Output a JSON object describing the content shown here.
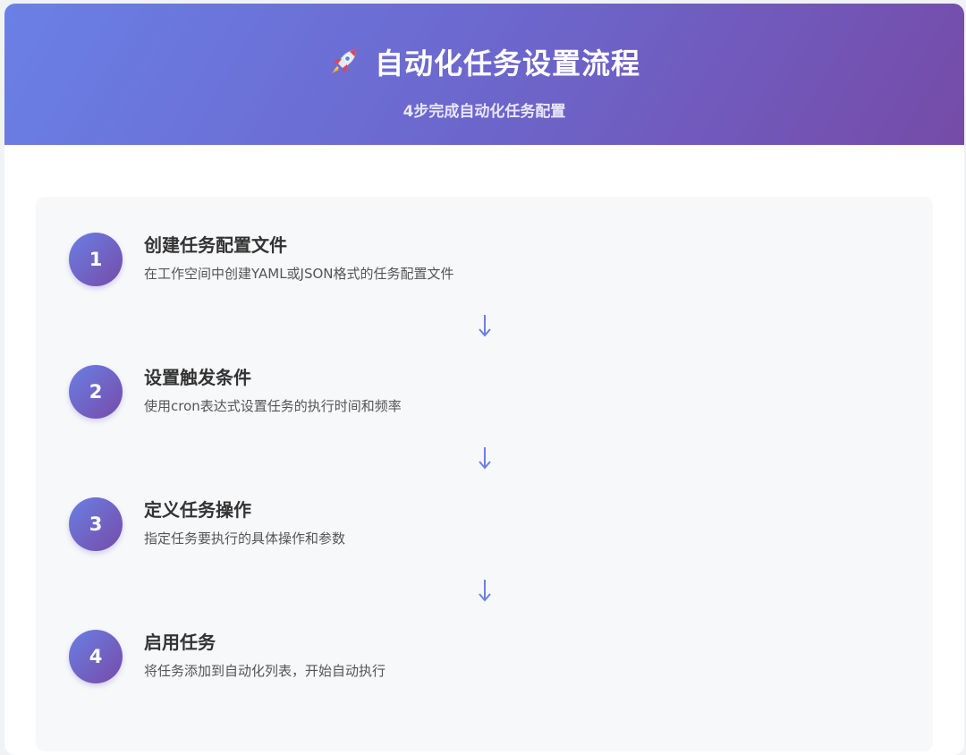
{
  "header": {
    "title": "自动化任务设置流程",
    "subtitle": "4步完成自动化任务配置",
    "icon": "rocket-icon"
  },
  "steps": [
    {
      "number": "1",
      "title": "创建任务配置文件",
      "description": "在工作空间中创建YAML或JSON格式的任务配置文件"
    },
    {
      "number": "2",
      "title": "设置触发条件",
      "description": "使用cron表达式设置任务的执行时间和频率"
    },
    {
      "number": "3",
      "title": "定义任务操作",
      "description": "指定任务要执行的具体操作和参数"
    },
    {
      "number": "4",
      "title": "启用任务",
      "description": "将任务添加到自动化列表，开始自动执行"
    }
  ],
  "colors": {
    "accent_start": "#667eea",
    "accent_end": "#764ba2",
    "arrow": "#6a7fe4"
  }
}
